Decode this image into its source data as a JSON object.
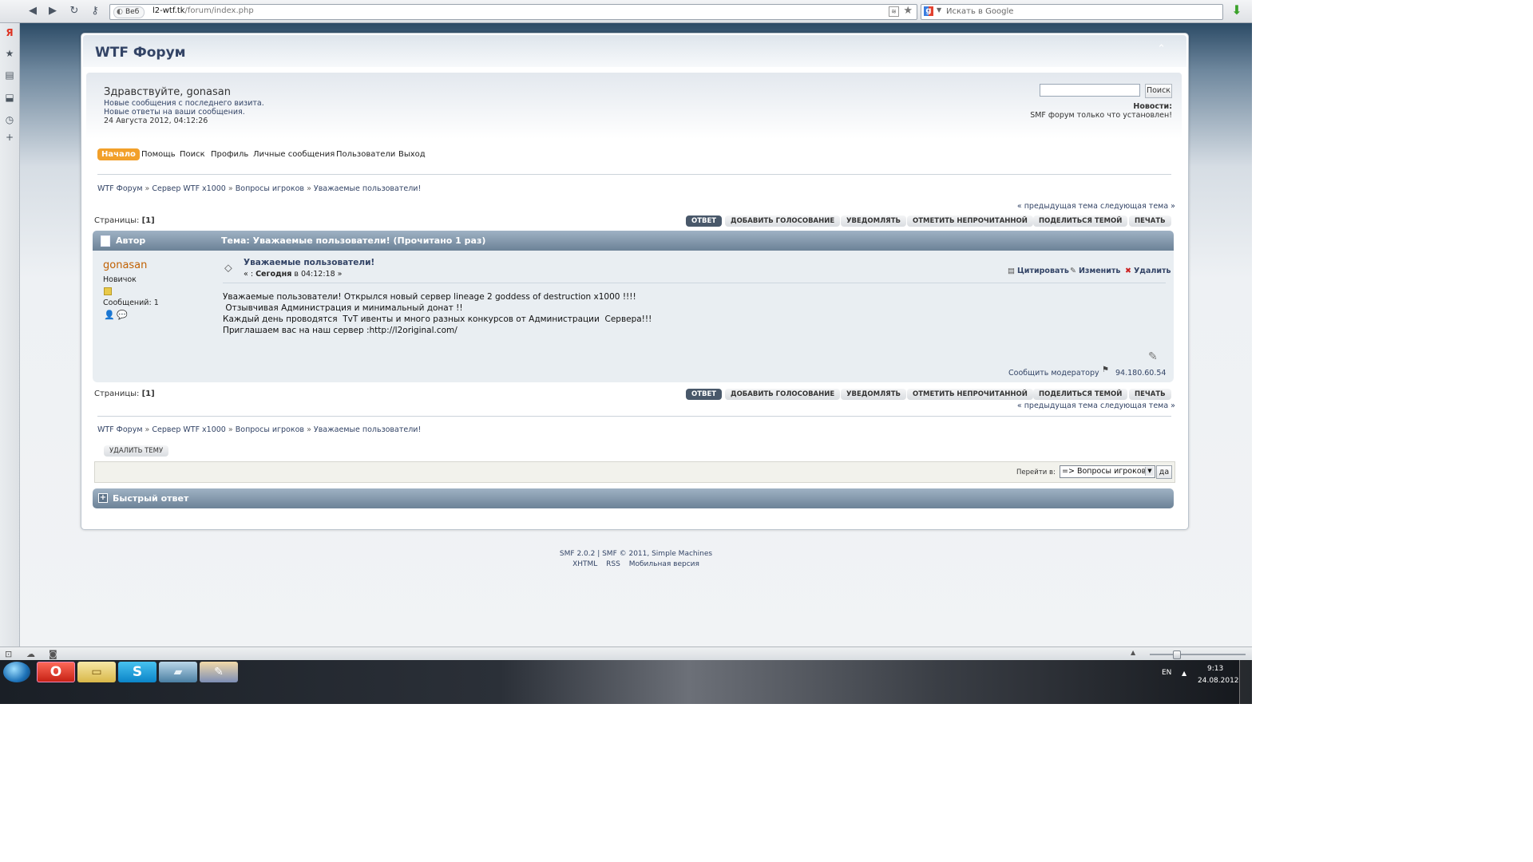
{
  "browser": {
    "address_badge": "Веб",
    "url_host": "l2-wtf.tk",
    "url_path": "/forum/index.php",
    "search_placeholder": "Искать в Google"
  },
  "forum": {
    "title": "WTF Форум",
    "greeting": "Здравствуйте, gonasan",
    "new_posts_link": "Новые сообщения с последнего визита.",
    "new_replies_link": "Новые ответы на ваши сообщения.",
    "datetime": "24 Августа 2012, 04:12:26",
    "search_button": "Поиск",
    "news_label": "Новости:",
    "news_text": "SMF форум только что установлен!"
  },
  "menu": {
    "items": [
      "Начало",
      "Помощь",
      "Поиск",
      "Профиль",
      "Личные сообщения",
      "Пользователи",
      "Выход"
    ]
  },
  "breadcrumb": {
    "items": [
      "WTF Форум",
      "Сервер WTF x1000",
      "Вопросы игроков",
      "Уважаемые пользователи!"
    ],
    "separator": "»"
  },
  "topic_nav": {
    "prev": "« предыдущая тема",
    "next": "следующая тема »",
    "pages_label": "Страницы:",
    "current_page": "[1]"
  },
  "buttons": {
    "reply": "ответ",
    "add_poll": "добавить голосование",
    "notify": "уведомлять",
    "mark_unread": "отметить непрочитанной",
    "share": "поделиться темой",
    "print": "печать",
    "delete_topic": "удалить тему"
  },
  "topic_header": {
    "author_col": "Автор",
    "topic_col": "Тема: Уважаемые пользователи!  (Прочитано 1 раз)"
  },
  "post": {
    "author": "gonasan",
    "rank": "Новичок",
    "posts_count": "Сообщений: 1",
    "subject": "Уважаемые пользователи!",
    "date_prefix": "« : ",
    "date_day": "Сегодня",
    "date_rest": " в 04:12:18 »",
    "actions": {
      "quote": "Цитировать",
      "edit": "Изменить",
      "delete": "Удалить"
    },
    "body": [
      "Уважаемые пользователи! Открылся новый сервер lineage 2 goddess of destruction x1000 !!!!",
      " Отзывчивая Администрация и минимальный донат !!",
      "Каждый день проводятся  TvT ивенты и много разных конкурсов от Администрации  Сервера!!!",
      "Приглашаем вас на наш сервер :http://l2original.com/"
    ],
    "report": "Сообщить модератору",
    "ip": "94.180.60.54"
  },
  "jump": {
    "label": "Перейти в:",
    "selected": "=> Вопросы игроков",
    "go": "да"
  },
  "quick_reply": {
    "title": "Быстрый ответ"
  },
  "footer": {
    "line1": "SMF 2.0.2 | SMF © 2011, Simple Machines",
    "links": [
      "XHTML",
      "RSS",
      "Мобильная версия"
    ]
  },
  "taskbar": {
    "lang": "EN",
    "time": "9:13",
    "date": "24.08.2012"
  },
  "colors": {
    "accent": "#f2a02a",
    "link": "#334466",
    "author": "#c06002",
    "catbar": "#7d92a7"
  },
  "icons": [
    "back-icon",
    "forward-icon",
    "reload-icon",
    "key-icon",
    "rss-icon",
    "bookmark-star-icon",
    "google-icon",
    "download-icon",
    "yandex-icon",
    "star-icon",
    "notes-icon",
    "downloads-icon",
    "history-icon",
    "add-panel-icon"
  ]
}
